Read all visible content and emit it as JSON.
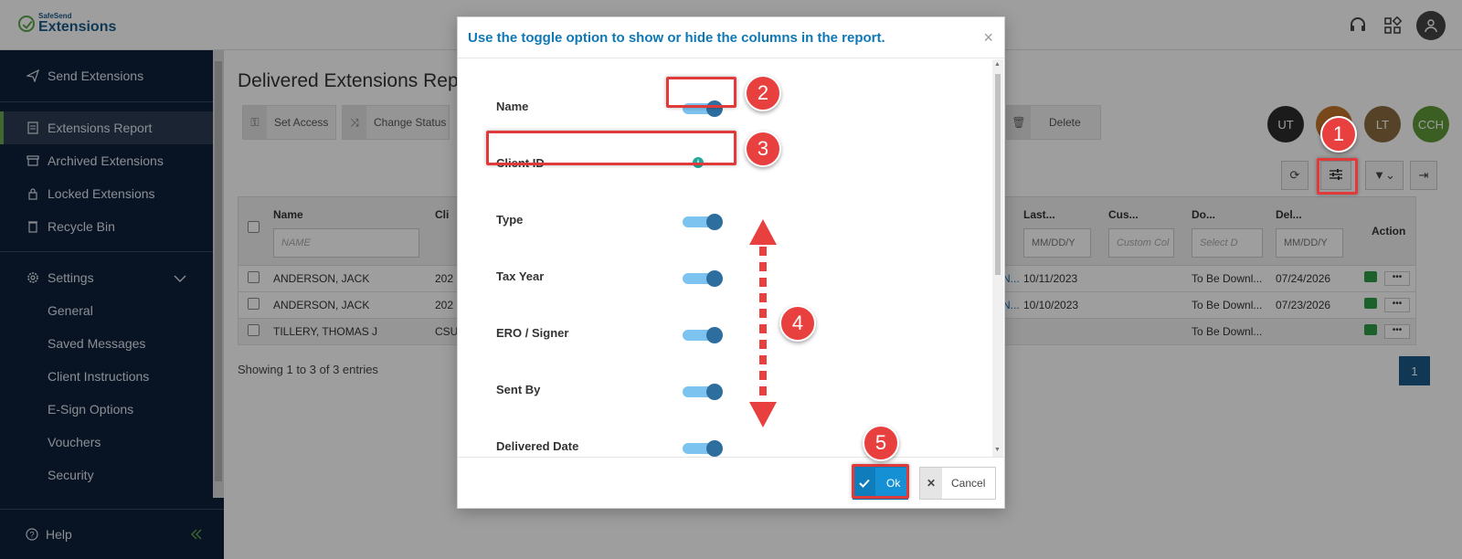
{
  "app": {
    "logo_small": "SafeSend",
    "logo_big": "Extensions"
  },
  "sidebar": {
    "items": [
      {
        "label": "Send Extensions",
        "icon": "send-icon"
      },
      {
        "label": "Extensions Report",
        "icon": "report-icon",
        "active": true
      },
      {
        "label": "Archived Extensions",
        "icon": "archive-icon"
      },
      {
        "label": "Locked Extensions",
        "icon": "lock-icon"
      },
      {
        "label": "Recycle Bin",
        "icon": "trash-icon"
      }
    ],
    "settings_label": "Settings",
    "settings_items": [
      "General",
      "Saved Messages",
      "Client Instructions",
      "E-Sign Options",
      "Vouchers",
      "Security"
    ],
    "help_label": "Help"
  },
  "main": {
    "title": "Delivered Extensions Rep",
    "toolbar": {
      "set_access": "Set Access",
      "change_status": "Change Status",
      "delete": "Delete"
    },
    "chips": [
      {
        "label": "UT",
        "color": "#2d2d2d"
      },
      {
        "label": "",
        "color": "#c4742a"
      },
      {
        "label": "LT",
        "color": "#8b6b3e"
      },
      {
        "label": "CCH",
        "color": "#5f9a38"
      }
    ],
    "table": {
      "columns": [
        "Name",
        "Cli",
        "Last...",
        "Cus...",
        "Do...",
        "Del...",
        "Action"
      ],
      "filters": {
        "name": "NAME",
        "last": "MM/DD/Y",
        "custom": "Custom Col",
        "doc": "Select D",
        "del": "MM/DD/Y"
      },
      "rows": [
        {
          "name": "ANDERSON, JACK",
          "client": "202",
          "link": "N...",
          "last": "10/11/2023",
          "custom": "",
          "doc": "To Be Downl...",
          "del": "07/24/2026"
        },
        {
          "name": "ANDERSON, JACK",
          "client": "202",
          "link": "N...",
          "last": "10/10/2023",
          "custom": "",
          "doc": "To Be Downl...",
          "del": "07/23/2026"
        },
        {
          "name": "TILLERY, THOMAS J",
          "client": "CSU",
          "link": "",
          "last": "",
          "custom": "",
          "doc": "To Be Downl...",
          "del": ""
        }
      ]
    },
    "showing": "Showing 1 to 3 of 3 entries",
    "page": "1"
  },
  "modal": {
    "title": "Use the toggle option to show or hide the columns in the report.",
    "close": "×",
    "columns": [
      {
        "label": "Name",
        "enabled": true
      },
      {
        "label": "Client ID",
        "enabled": null
      },
      {
        "label": "Type",
        "enabled": true
      },
      {
        "label": "Tax Year",
        "enabled": true
      },
      {
        "label": "ERO / Signer",
        "enabled": true
      },
      {
        "label": "Sent By",
        "enabled": true
      },
      {
        "label": "Delivered Date",
        "enabled": true
      }
    ],
    "ok_label": "Ok",
    "cancel_label": "Cancel"
  },
  "annotations": [
    "1",
    "2",
    "3",
    "4",
    "5"
  ],
  "colors": {
    "sidebar_bg": "#0d1f3b",
    "accent": "#1690d4",
    "annotation": "#e8403f",
    "toggle_track": "#7cc4ef",
    "toggle_knob": "#2d6e9e"
  }
}
